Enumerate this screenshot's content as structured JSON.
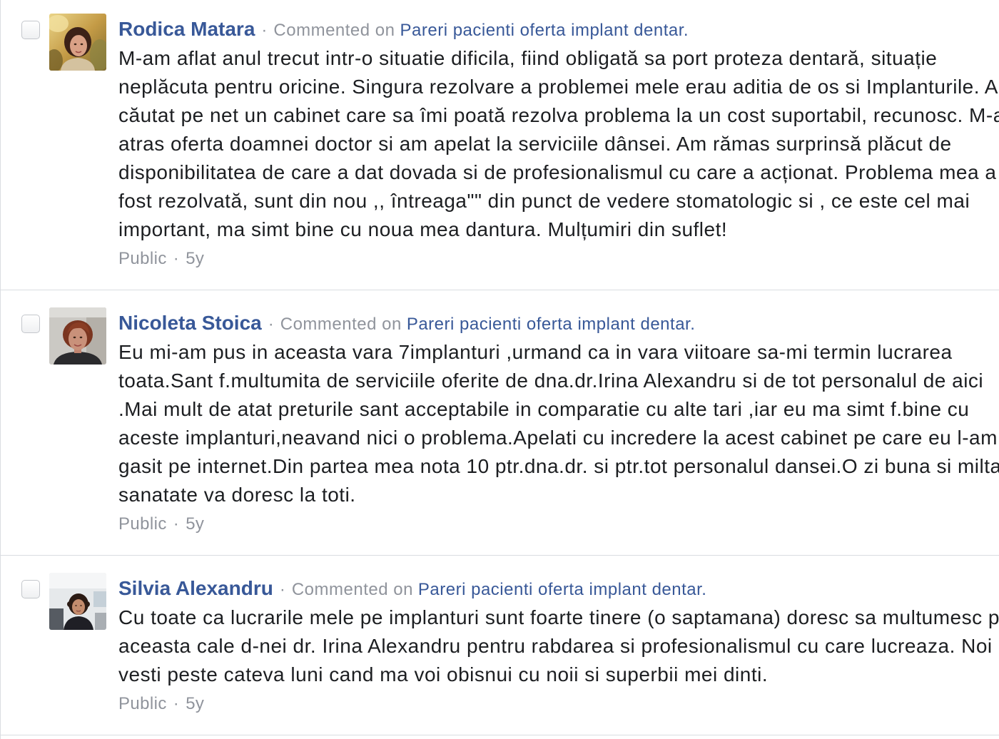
{
  "separator": "·",
  "colors": {
    "link": "#385898",
    "meta": "#90949c",
    "text": "#1c1e21",
    "divider": "#dadde1"
  },
  "comments": [
    {
      "selected": false,
      "author": "Rodica Matara",
      "action": "Commented on",
      "target": "Pareri pacienti oferta implant dentar.",
      "text_lines": [
        "M-am aflat anul trecut intr-o situatie dificila, fiind obligată sa port proteza dentară, situație",
        "neplăcuta pentru oricine. Singura rezolvare a problemei mele erau aditia de os si Implanturile. Am",
        "căutat pe net un cabinet care sa îmi poată rezolva problema la un cost suportabil, recunosc. M-a",
        "atras oferta doamnei doctor si am apelat la serviciile dânsei. Am rămas surprinsă plăcut de",
        "disponibilitatea de care a dat dovada si de profesionalismul cu care a acționat. Problema mea a",
        "fost rezolvată, sunt din nou ,, întreaga\"\" din punct de vedere stomatologic si , ce este cel mai",
        "important, ma simt bine cu noua mea dantura. Mulțumiri din suflet!"
      ],
      "privacy": "Public",
      "age": "5y"
    },
    {
      "selected": false,
      "author": "Nicoleta Stoica",
      "action": "Commented on",
      "target": "Pareri pacienti oferta implant dentar.",
      "text_lines": [
        "Eu mi-am pus in aceasta vara 7implanturi ,urmand ca in vara viitoare sa-mi termin lucrarea",
        "toata.Sant f.multumita de serviciile oferite de dna.dr.Irina Alexandru si de tot personalul de aici",
        ".Mai mult de atat preturile sant acceptabile in comparatie cu alte tari ,iar eu ma simt f.bine cu",
        "aceste implanturi,neavand nici o problema.Apelati cu incredere la acest cabinet pe care eu l-am",
        "gasit pe internet.Din partea mea nota 10 ptr.dna.dr. si ptr.tot personalul dansei.O zi buna si milta",
        "sanatate va doresc la toti."
      ],
      "privacy": "Public",
      "age": "5y"
    },
    {
      "selected": false,
      "author": "Silvia Alexandru",
      "action": "Commented on",
      "target": "Pareri pacienti oferta implant dentar.",
      "text_lines": [
        "Cu toate ca lucrarile mele pe implanturi sunt foarte tinere (o saptamana) doresc sa multumesc p",
        "aceasta cale d-nei dr. Irina Alexandru pentru rabdarea si profesionalismul cu care lucreaza. Noi",
        "vesti peste cateva luni cand ma voi obisnui cu noii si superbii mei dinti."
      ],
      "privacy": "Public",
      "age": "5y"
    }
  ]
}
